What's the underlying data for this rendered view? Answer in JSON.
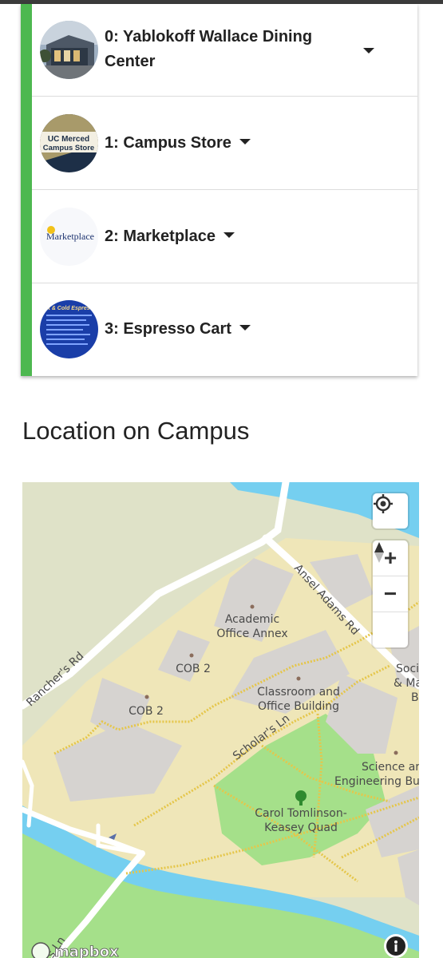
{
  "dining_list": {
    "accent_color": "#4db850",
    "items": [
      {
        "label_line1": "0: Yablokoff Wallace Dining",
        "label_line2": "Center",
        "thumb": "building-photo"
      },
      {
        "label": "1: Campus Store",
        "thumb": "campus-store-logo",
        "logo_line1": "UC Merced",
        "logo_line2": "Campus Store"
      },
      {
        "label": "2: Marketplace",
        "thumb": "marketplace-logo",
        "logo_text": "Marketplace"
      },
      {
        "label": "3: Espresso Cart",
        "thumb": "espresso-menu",
        "logo_text": "Hot & Cold Espresso"
      }
    ]
  },
  "location": {
    "heading": "Location on Campus"
  },
  "map": {
    "labels": {
      "ansel": "Ansel Adams Rd",
      "ranchers": "Rancher's Rd",
      "scholars": "Scholar's Ln",
      "bottom_ln": "s Ln",
      "aoa1": "Academic",
      "aoa2": "Office Annex",
      "cob2a": "COB 2",
      "cob2b": "COB 2",
      "cob1": "Classroom and",
      "cob1b": "Office Building",
      "se1": "Science ar",
      "se2": "Engineering Bu",
      "ssm1": "Soci",
      "ssm2": "& Ma",
      "ssm3": "B",
      "quad1": "Carol Tomlinson-",
      "quad2": "Keasey Quad",
      "brand": "mapbox"
    },
    "colors": {
      "water": "#75cff0",
      "land": "#efe6b8",
      "building": "#d6d3d0",
      "park": "#a5e08a"
    },
    "controls": {
      "locate": "locate-icon",
      "zoom_in": "+",
      "zoom_out": "−",
      "compass": "compass-icon",
      "info": "i"
    }
  }
}
